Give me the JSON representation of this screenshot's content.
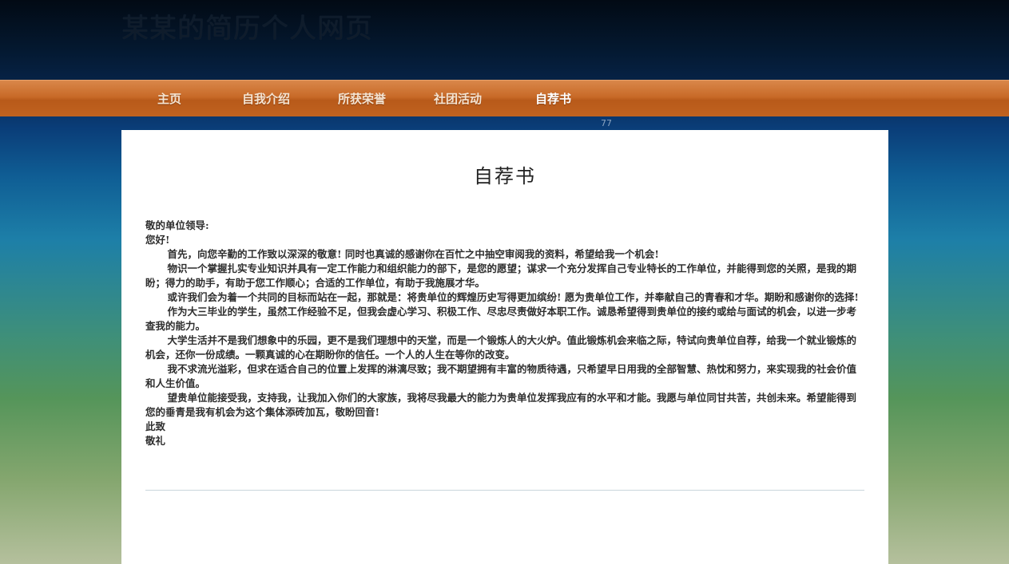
{
  "header": {
    "title": "某某的简历个人网页"
  },
  "nav": {
    "items": [
      {
        "label": "主页"
      },
      {
        "label": "自我介绍"
      },
      {
        "label": "所获荣誉"
      },
      {
        "label": "社团活动"
      },
      {
        "label": "自荐书"
      }
    ],
    "active_index": 4
  },
  "counter": "77",
  "main": {
    "heading": "自荐书",
    "letter": {
      "salutation": "敬的单位领导:",
      "greeting": "您好!",
      "paragraphs": [
        "首先，向您辛勤的工作致以深深的敬意! 同时也真诚的感谢你在百忙之中抽空审阅我的资料，希望给我一个机会!",
        "物识一个掌握扎实专业知识并具有一定工作能力和组织能力的部下，是您的愿望；谋求一个充分发挥自己专业特长的工作单位，并能得到您的关照，是我的期盼；得力的助手，有助于您工作顺心；合适的工作单位，有助于我施展才华。",
        "或许我们会为着一个共同的目标而站在一起，那就是：将贵单位的辉煌历史写得更加缤纷! 愿为贵单位工作，并奉献自己的青春和才华。期盼和感谢你的选择!",
        "作为大三毕业的学生，虽然工作经验不足，但我会虚心学习、积极工作、尽忠尽责做好本职工作。诚恳希望得到贵单位的接约或给与面试的机会，以进一步考查我的能力。",
        "大学生活并不是我们想象中的乐园，更不是我们理想中的天堂，而是一个锻炼人的大火炉。值此锻炼机会来临之际，特试向贵单位自荐，给我一个就业锻炼的机会，还你一份成绩。一颗真诚的心在期盼你的信任。一个人的人生在等你的改变。",
        "我不求流光溢彩，但求在适合自己的位置上发挥的淋漓尽致；我不期望拥有丰富的物质待遇，只希望早日用我的全部智慧、热忱和努力，来实现我的社会价值和人生价值。",
        "望贵单位能接受我，支持我，让我加入你们的大家族，我将尽我最大的能力为贵单位发挥我应有的水平和才能。我愿与单位同甘共苦，共创未来。希望能得到您的垂青是我有机会为这个集体添砖加瓦，敬盼回音!"
      ],
      "closing_1": "此致",
      "closing_2": "敬礼"
    }
  }
}
